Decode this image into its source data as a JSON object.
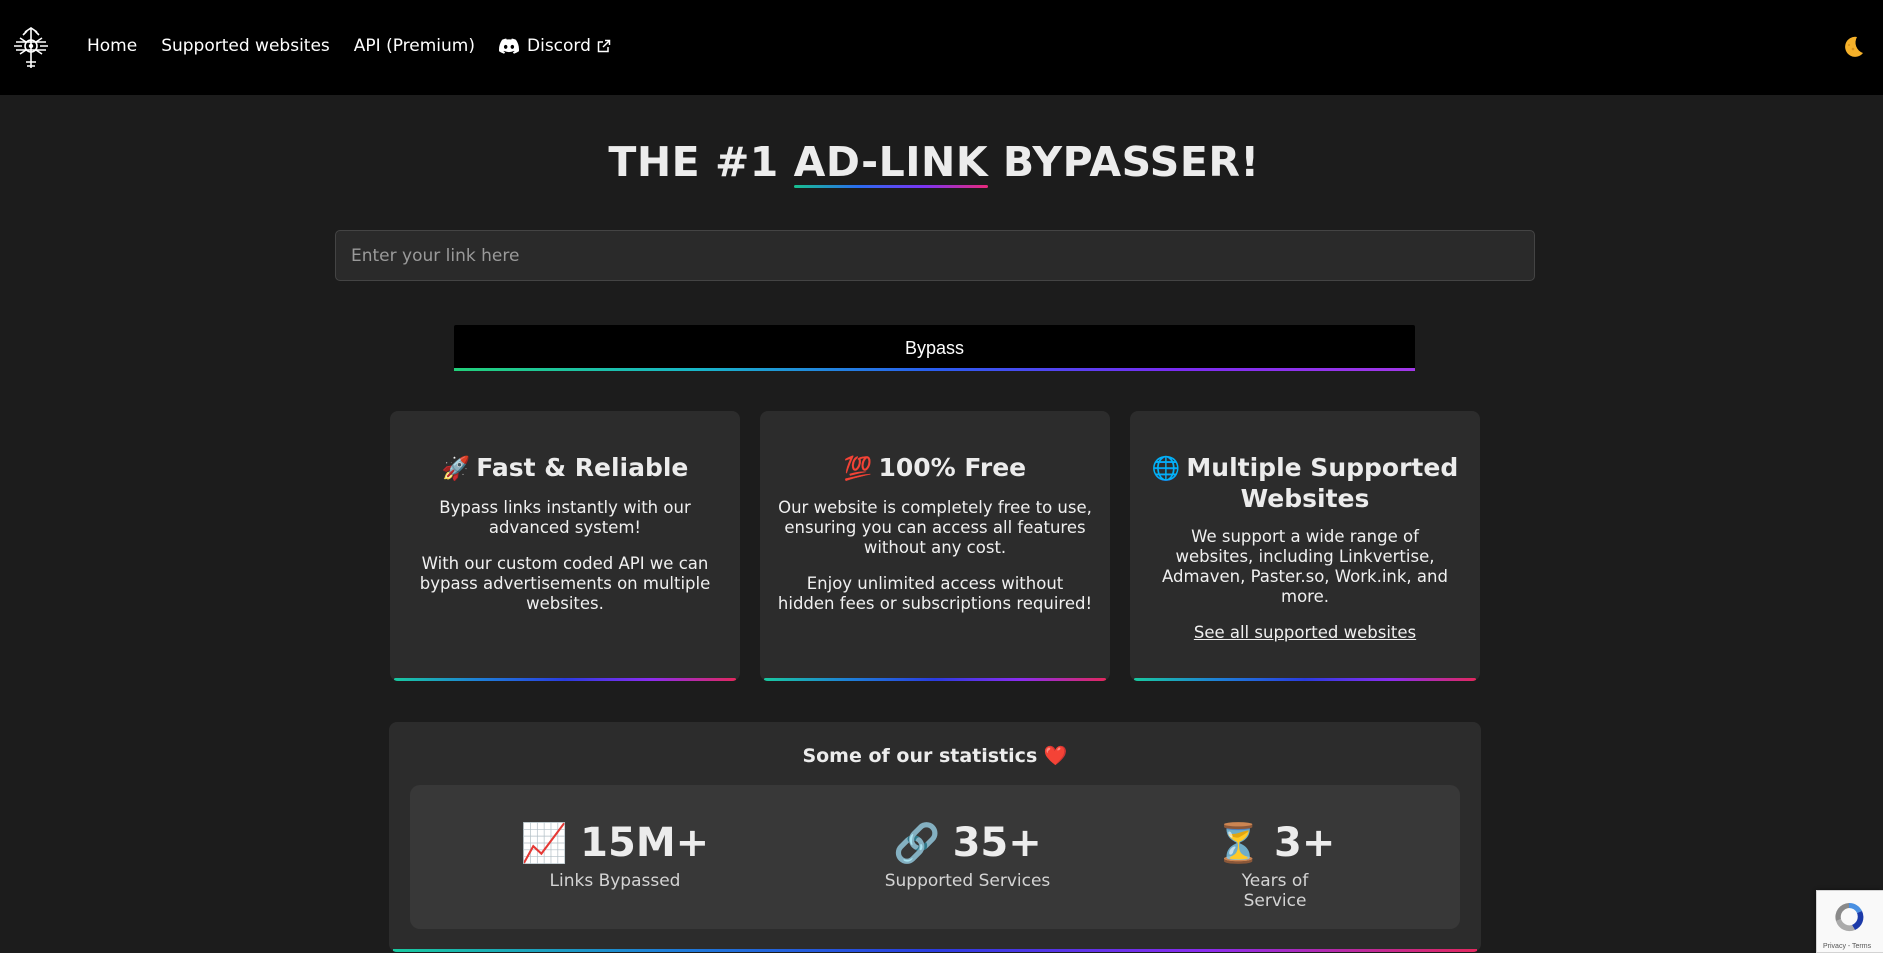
{
  "nav": {
    "links": [
      "Home",
      "Supported websites",
      "API (Premium)"
    ],
    "discord_label": "Discord",
    "theme_icon": "moon-icon"
  },
  "hero": {
    "title_prefix": "THE #1 ",
    "title_highlight": "AD-LINK",
    "title_suffix": " BYPASSER!",
    "input_placeholder": "Enter your link here",
    "input_value": "",
    "button_label": "Bypass"
  },
  "features": [
    {
      "emoji": "🚀",
      "title": "Fast & Reliable",
      "paragraphs": [
        "Bypass links instantly with our advanced system!",
        "With our custom coded API we can bypass advertisements on multiple websites."
      ]
    },
    {
      "emoji": "💯",
      "title": "100% Free",
      "paragraphs": [
        "Our website is completely free to use, ensuring you can access all features without any cost.",
        "Enjoy unlimited access without hidden fees or subscriptions required!"
      ]
    },
    {
      "emoji": "🌐",
      "title": "Multiple Supported Websites",
      "paragraphs": [
        "We support a wide range of websites, including Linkvertise, Admaven, Paster.so, Work.ink, and more."
      ],
      "link": "See all supported websites"
    }
  ],
  "stats": {
    "title": "Some of our statistics",
    "title_emoji": "❤️",
    "items": [
      {
        "emoji": "📈",
        "value": "15M+",
        "label": "Links Bypassed"
      },
      {
        "emoji": "🔗",
        "value": "35+",
        "label": "Supported Services"
      },
      {
        "emoji": "⏳",
        "value": "3+",
        "label": "Years of Service"
      }
    ]
  },
  "recaptcha": {
    "footer": "Privacy - Terms"
  },
  "colors": {
    "nav_bg": "#000000",
    "page_bg": "#1c1c1c",
    "card_bg": "#2c2c2c",
    "stats_inner_bg": "#383838",
    "accent_gradient": [
      "#19c9a0",
      "#1e7fd8",
      "#2a3ce0",
      "#8b2cf0",
      "#e2285f"
    ]
  }
}
